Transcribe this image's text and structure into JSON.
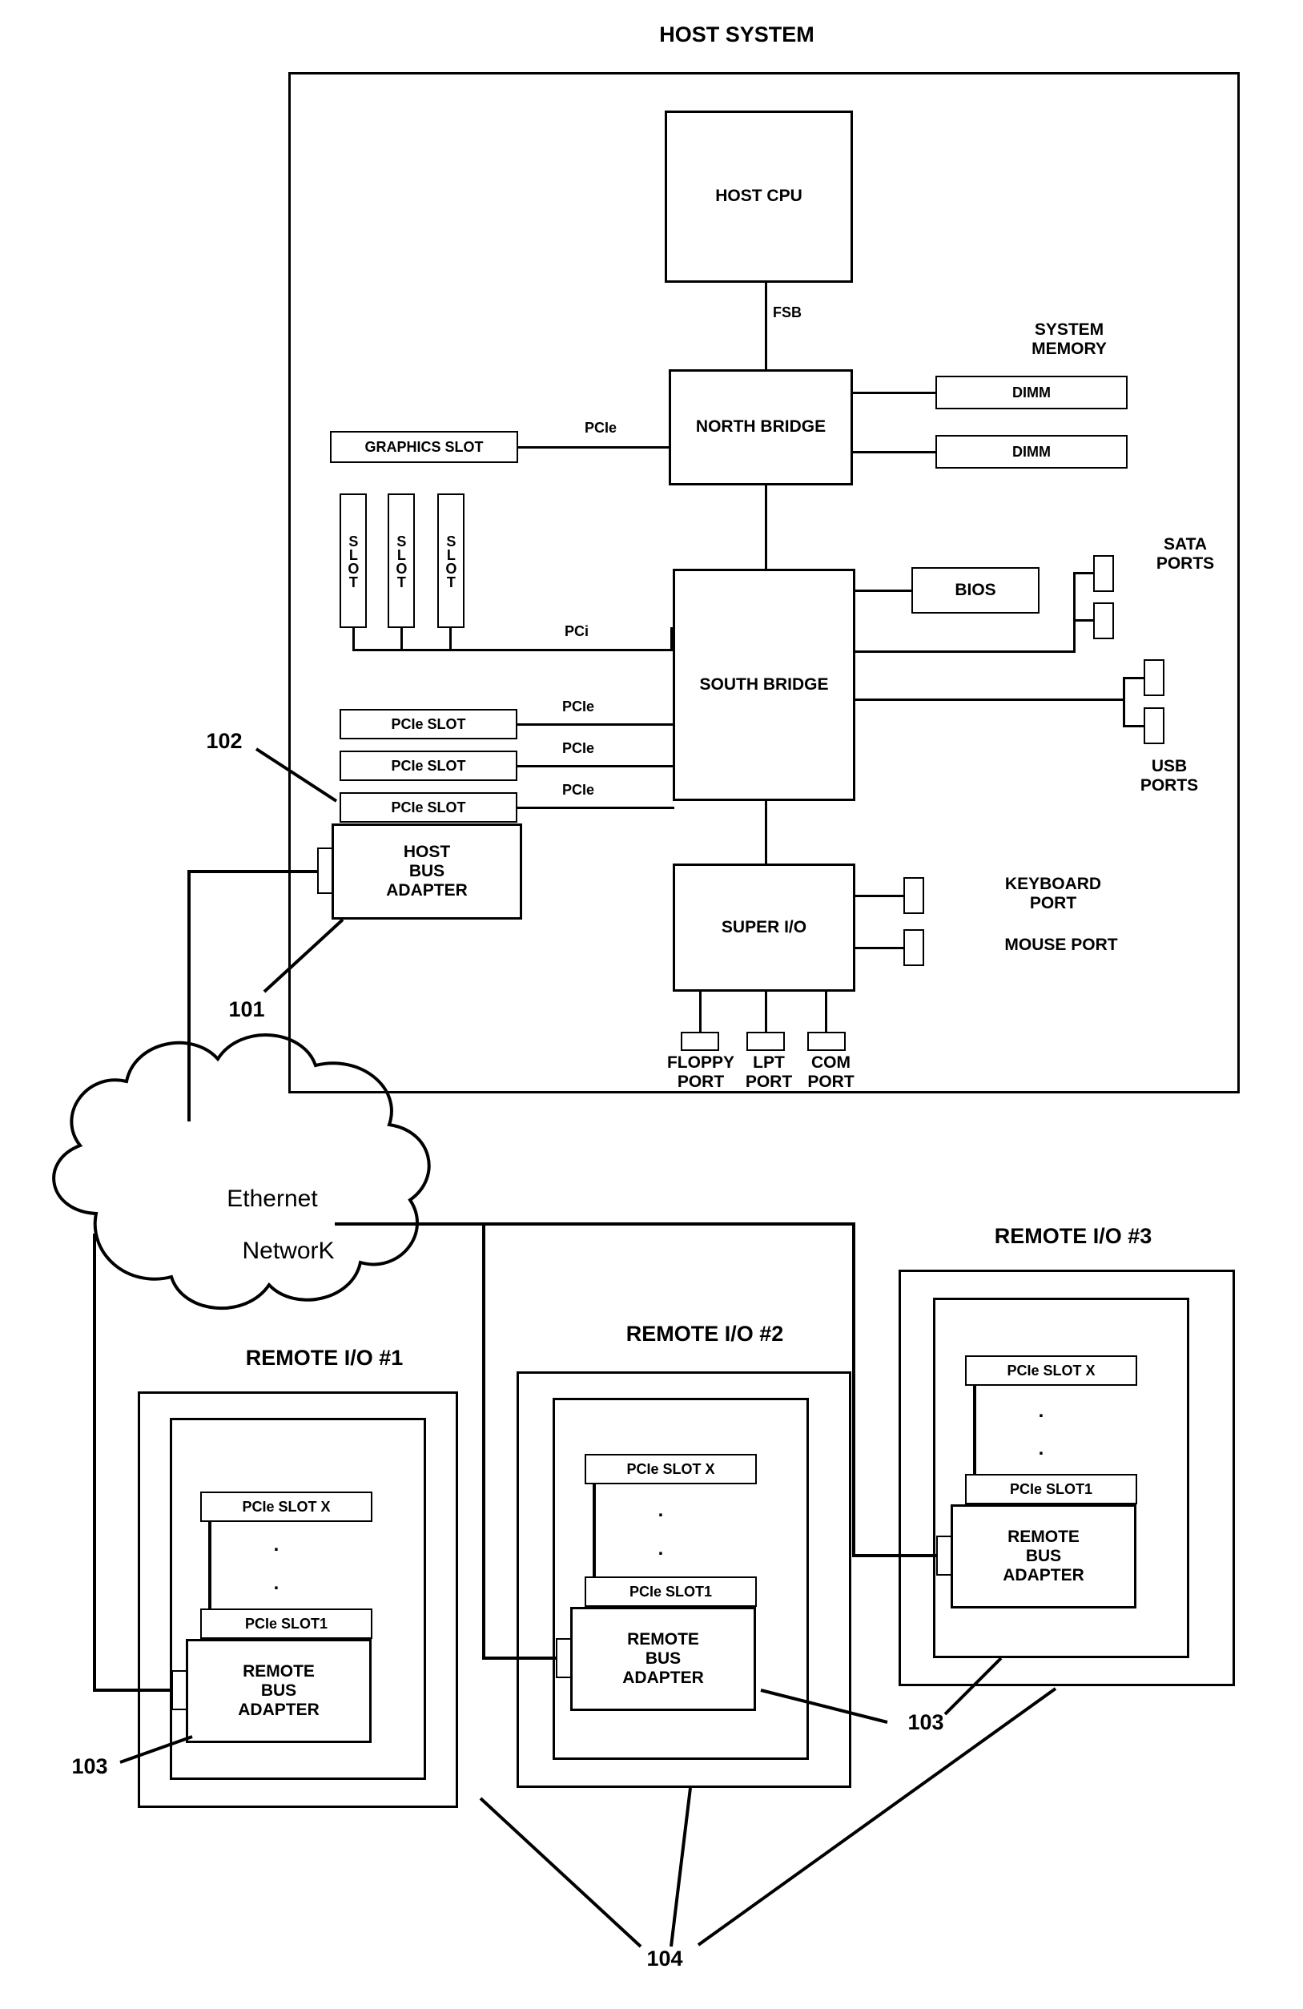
{
  "diagram": {
    "title": "HOST SYSTEM",
    "host": {
      "cpu": "HOST CPU",
      "fsb": "FSB",
      "north_bridge": "NORTH BRIDGE",
      "south_bridge": "SOUTH BRIDGE",
      "super_io": "SUPER I/O",
      "bios": "BIOS",
      "graphics_slot": "GRAPHICS SLOT",
      "pcie_label_graphics": "PCIe",
      "system_memory": "SYSTEM\nMEMORY",
      "dimm1": "DIMM",
      "dimm2": "DIMM",
      "slot_vertical": "SLOT",
      "pci_label": "PCi",
      "pcie_slot": "PCIe SLOT",
      "pcie_label": "PCIe",
      "host_bus_adapter": "HOST\nBUS\nADAPTER",
      "sata_ports": "SATA\nPORTS",
      "usb_ports": "USB\nPORTS",
      "keyboard_port": "KEYBOARD\nPORT",
      "mouse_port": "MOUSE PORT",
      "floppy_port": "FLOPPY\nPORT",
      "lpt_port": "LPT\nPORT",
      "com_port": "COM\nPORT"
    },
    "callouts": {
      "c101": "101",
      "c102": "102",
      "c103_a": "103",
      "c103_b": "103",
      "c103_c": "103",
      "c104": "104"
    },
    "cloud": {
      "line1": "Ethernet",
      "line2": "NetworK"
    },
    "remote1": {
      "title": "REMOTE I/O #1",
      "slot_x": "PCIe SLOT X",
      "slot_1": "PCIe SLOT1",
      "adapter": "REMOTE\nBUS\nADAPTER",
      "dots": "."
    },
    "remote2": {
      "title": "REMOTE I/O #2",
      "slot_x": "PCIe SLOT X",
      "slot_1": "PCIe SLOT1",
      "adapter": "REMOTE\nBUS\nADAPTER",
      "dots": "."
    },
    "remote3": {
      "title": "REMOTE I/O #3",
      "slot_x": "PCIe SLOT X",
      "slot_1": "PCIe SLOT1",
      "adapter": "REMOTE\nBUS\nADAPTER",
      "dots": "."
    }
  }
}
